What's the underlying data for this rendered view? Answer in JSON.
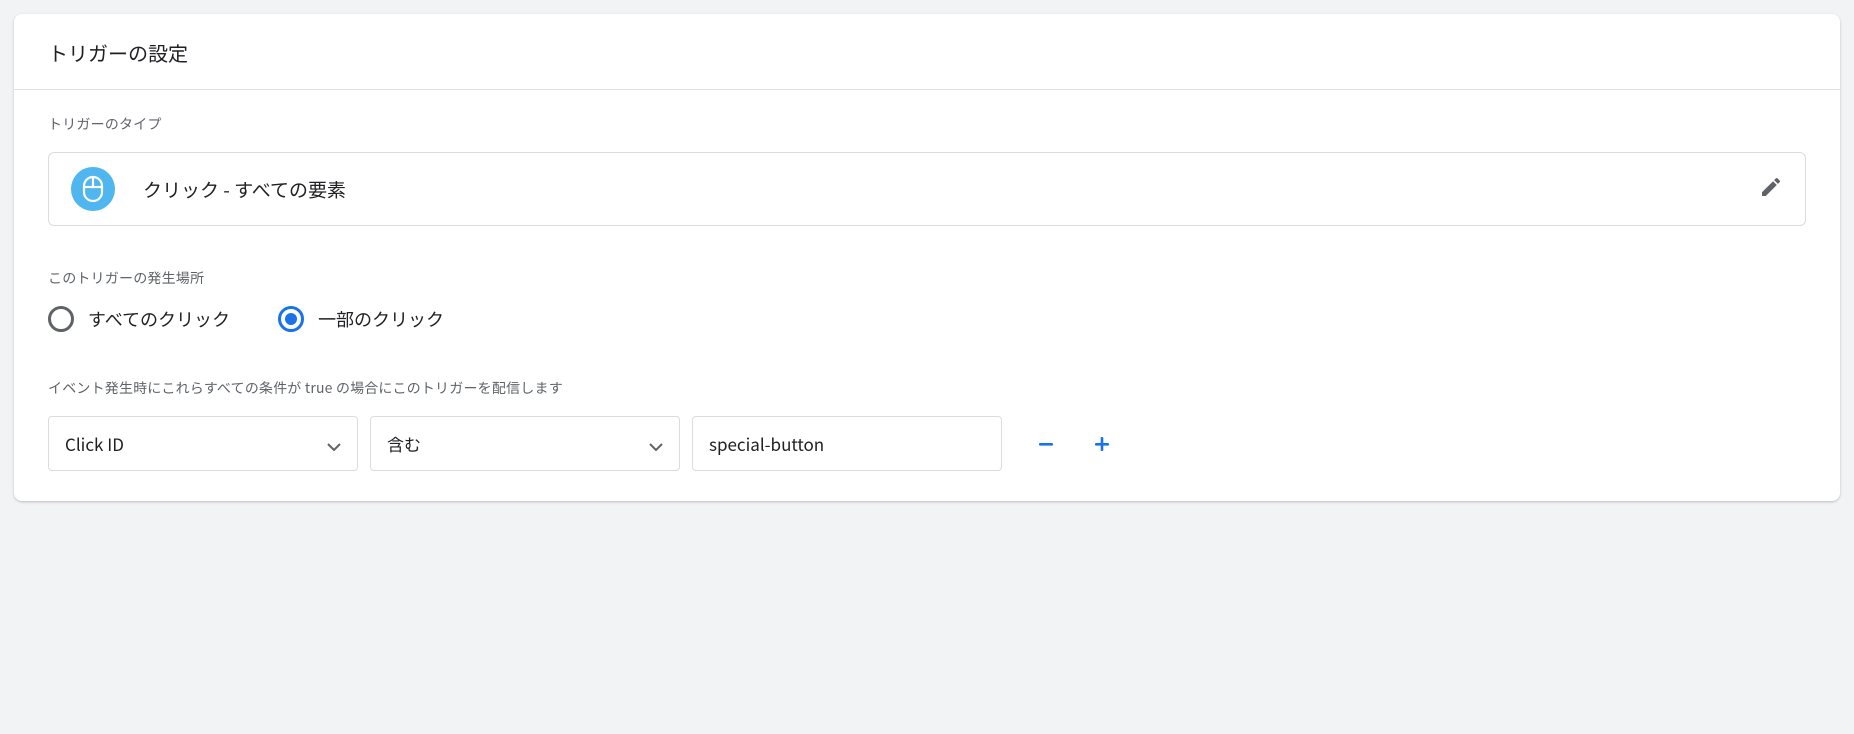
{
  "header": {
    "title": "トリガーの設定"
  },
  "trigger_type": {
    "label": "トリガーのタイプ",
    "value": "クリック - すべての要素"
  },
  "fire_on": {
    "label": "このトリガーの発生場所",
    "options": {
      "all": {
        "label": "すべてのクリック",
        "selected": false
      },
      "some": {
        "label": "一部のクリック",
        "selected": true
      }
    }
  },
  "conditions": {
    "label": "イベント発生時にこれらすべての条件が true の場合にこのトリガーを配信します",
    "rows": [
      {
        "variable": "Click ID",
        "operator": "含む",
        "value": "special-button"
      }
    ]
  }
}
